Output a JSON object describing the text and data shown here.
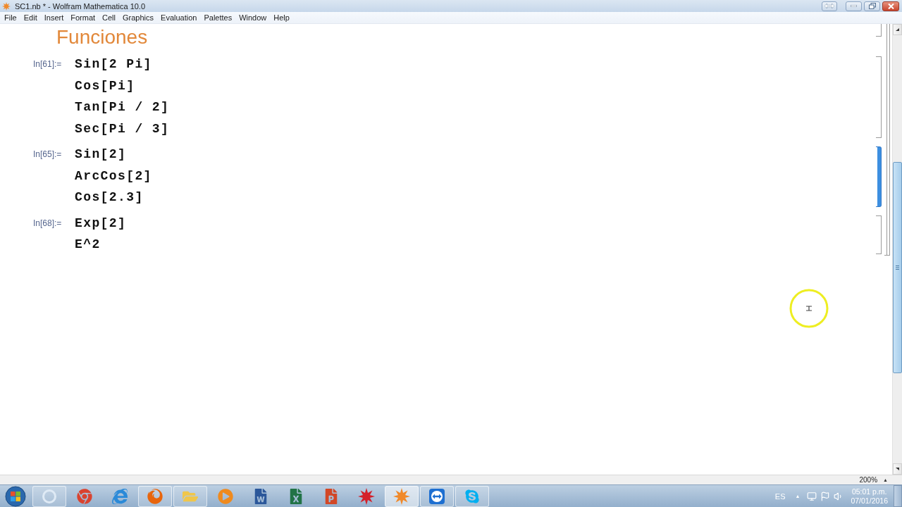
{
  "window": {
    "title": "SC1.nb * - Wolfram Mathematica 10.0"
  },
  "menu": [
    "File",
    "Edit",
    "Insert",
    "Format",
    "Cell",
    "Graphics",
    "Evaluation",
    "Palettes",
    "Window",
    "Help"
  ],
  "notebook": {
    "heading": "Funciones",
    "cells": [
      {
        "label": "In[61]:=",
        "lines": [
          "Sin[2 Pi]",
          "Cos[Pi]",
          "Tan[Pi / 2]",
          "Sec[Pi / 3]"
        ],
        "selected": false
      },
      {
        "label": "In[65]:=",
        "lines": [
          "Sin[2]",
          "ArcCos[2]",
          "Cos[2.3]"
        ],
        "selected": true
      },
      {
        "label": "In[68]:=",
        "lines": [
          "Exp[2]",
          "E^2"
        ],
        "selected": false
      }
    ]
  },
  "status_bar": {
    "zoom": "200%",
    "zoom_arrow": "▲"
  },
  "taskbar": {
    "apps": [
      {
        "kind": "recorder",
        "running": true,
        "selected": false
      },
      {
        "kind": "chrome",
        "running": false,
        "selected": false
      },
      {
        "kind": "ie",
        "running": false,
        "selected": false
      },
      {
        "kind": "firefox",
        "running": true,
        "selected": false
      },
      {
        "kind": "explorer",
        "running": true,
        "selected": false
      },
      {
        "kind": "mediaplayer",
        "running": false,
        "selected": false
      },
      {
        "kind": "word",
        "running": false,
        "selected": false
      },
      {
        "kind": "excel",
        "running": false,
        "selected": false
      },
      {
        "kind": "powerpoint",
        "running": false,
        "selected": false
      },
      {
        "kind": "redstar",
        "running": false,
        "selected": false
      },
      {
        "kind": "mathematica",
        "running": true,
        "selected": true
      },
      {
        "kind": "teamviewer",
        "running": true,
        "selected": false
      },
      {
        "kind": "skype",
        "running": true,
        "selected": false
      }
    ],
    "tray": {
      "language": "ES",
      "overflow": "▲",
      "time": "05:01 p.m.",
      "date": "07/01/2016"
    }
  }
}
